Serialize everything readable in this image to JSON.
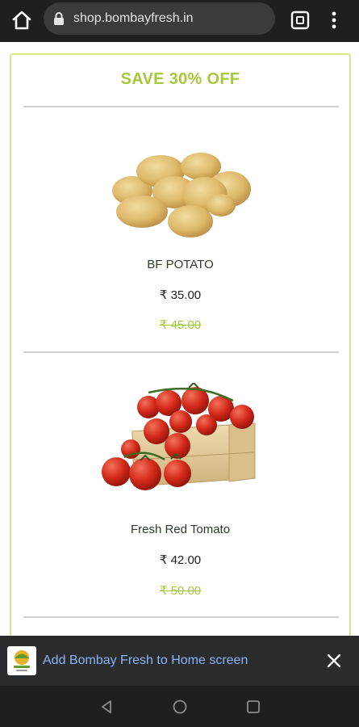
{
  "browser": {
    "url": "shop.bombayfresh.in",
    "icons": {
      "home": "home-icon",
      "lock": "lock-icon",
      "tabs": "tabs-icon",
      "menu": "more-vert-icon"
    }
  },
  "promo": {
    "title": "SAVE 30% OFF",
    "accent_color": "#a4c93b"
  },
  "products": [
    {
      "name": "BF POTATO",
      "price": "₹ 35.00",
      "old_price": "₹ 45.00"
    },
    {
      "name": "Fresh Red Tomato",
      "price": "₹ 42.00",
      "old_price": "₹ 50.00"
    }
  ],
  "add_to_home": {
    "text": "Add Bombay Fresh to Home screen",
    "icons": {
      "logo": "bombay-fresh-logo-icon",
      "close": "close-icon"
    }
  },
  "system_nav": {
    "icons": {
      "back": "nav-back-icon",
      "home": "nav-home-icon",
      "recents": "nav-recents-icon"
    }
  }
}
